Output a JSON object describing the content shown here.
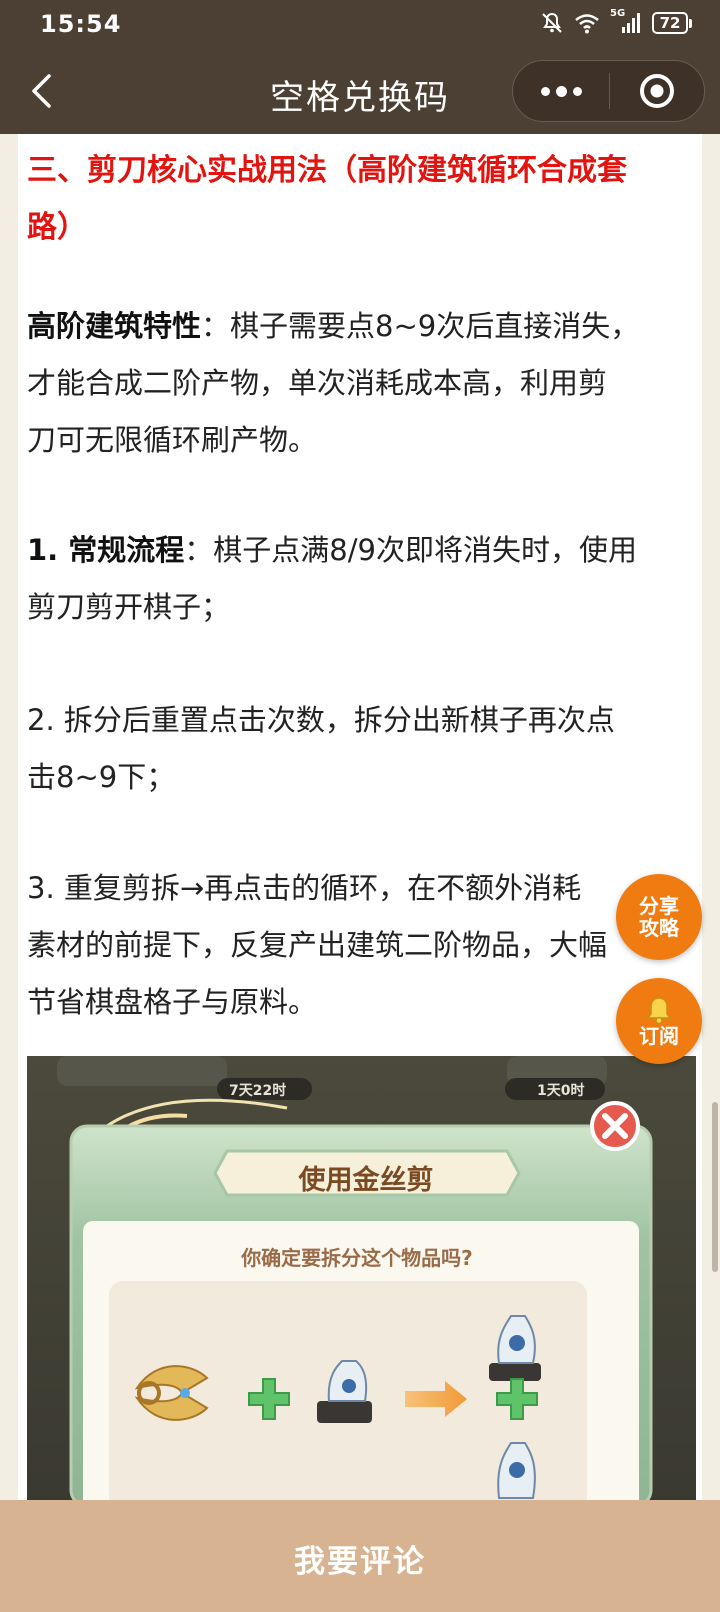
{
  "status_bar": {
    "time": "15:54",
    "network": "5G",
    "battery": "72"
  },
  "nav": {
    "title": "空格兑换码",
    "back_icon": "chevron-left-icon",
    "more_icon": "more-dots-icon",
    "close_icon": "target-close-icon"
  },
  "article": {
    "heading_line1": "三、剪刀核心实战用法（高阶建筑循环合成套",
    "heading_line2": "路）",
    "p1_bold": "高阶建筑特性",
    "p1_line1": "：棋子需要点8~9次后直接消失，",
    "p1_line2": "才能合成二阶产物，单次消耗成本高，利用剪",
    "p1_line3": "刀可无限循环刷产物。",
    "p2_bold": "1. 常规流程",
    "p2_line1": "：棋子点满8/9次即将消失时，使用",
    "p2_line2": "剪刀剪开棋子；",
    "p3_line1": "2. 拆分后重置点击次数，拆分出新棋子再次点",
    "p3_line2": "击8~9下；",
    "p4_line1": "3. 重复剪拆→再点击的循环，在不额外消耗",
    "p4_line2": "素材的前提下，反复产出建筑二阶物品，大幅",
    "p4_line3": "节省棋盘格子与原料。"
  },
  "screenshot": {
    "timer_left": "7天22时",
    "timer_right": "1天0时",
    "dialog_title": "使用金丝剪",
    "dialog_question": "你确定要拆分这个物品吗?"
  },
  "floating": {
    "share_line1": "分享",
    "share_line2": "攻略",
    "subscribe_label": "订阅",
    "bell_icon": "bell-icon"
  },
  "bottom": {
    "comment_label": "我要评论"
  },
  "colors": {
    "header_bg": "#4c3f33",
    "heading_red": "#e3140f",
    "float_orange": "#f07c11",
    "comment_bar": "#d8b391"
  }
}
